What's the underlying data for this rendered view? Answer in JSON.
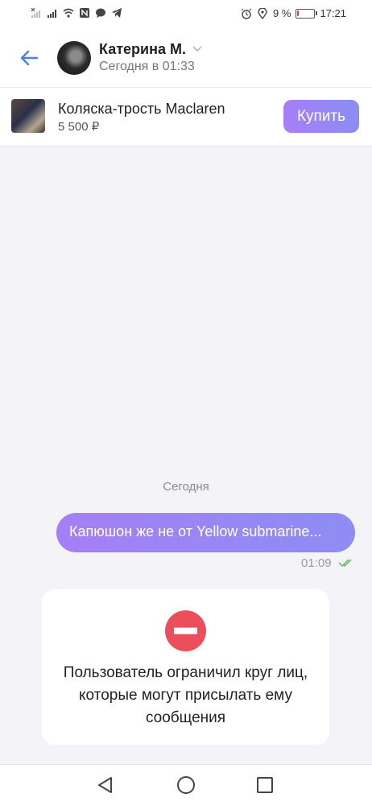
{
  "status_bar": {
    "battery_percent": "9 %",
    "time": "17:21",
    "left_icons": [
      "signal-off-icon",
      "signal-icon",
      "wifi-icon",
      "nfc-icon",
      "chat-bubble-icon",
      "telegram-icon"
    ],
    "right_icons": [
      "alarm-icon",
      "location-icon",
      "battery-icon"
    ],
    "battery_level": 0.09,
    "battery_color": "#e53935"
  },
  "header": {
    "contact_name": "Катерина М.",
    "last_seen": "Сегодня в 01:33",
    "back_icon": "arrow-left-icon",
    "accent": "#4a7fe8"
  },
  "product": {
    "title": "Коляска-трость Maclaren",
    "price": "5 500 ₽",
    "buy_label": "Купить"
  },
  "chat": {
    "date_separator": "Сегодня",
    "messages": [
      {
        "text": "Капюшон же не от Yellow submarine...",
        "time": "01:09",
        "status": "read"
      }
    ],
    "notice": "Пользователь ограничил круг лиц, которые могут присылать ему сообщения",
    "notice_icon": "stop-icon",
    "notice_icon_color": "#ec4e5c"
  },
  "nav": {
    "icons": [
      "back-triangle-icon",
      "home-circle-icon",
      "recents-square-icon"
    ]
  }
}
